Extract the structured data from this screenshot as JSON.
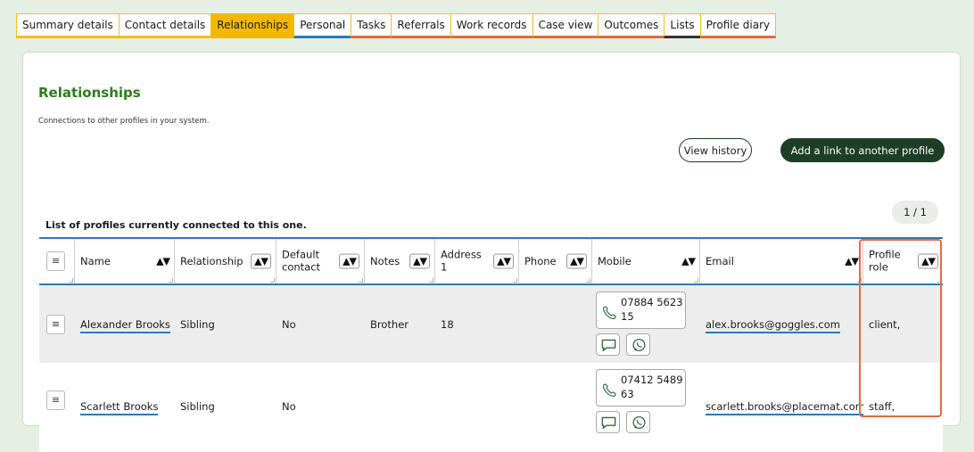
{
  "tabs": [
    {
      "label": "Summary details",
      "active": false
    },
    {
      "label": "Contact details",
      "active": false
    },
    {
      "label": "Relationships",
      "active": true
    },
    {
      "label": "Personal",
      "active": false
    },
    {
      "label": "Tasks",
      "active": false
    },
    {
      "label": "Referrals",
      "active": false
    },
    {
      "label": "Work records",
      "active": false
    },
    {
      "label": "Case view",
      "active": false
    },
    {
      "label": "Outcomes",
      "active": false
    },
    {
      "label": "Lists",
      "active": false
    },
    {
      "label": "Profile diary",
      "active": false
    }
  ],
  "page": {
    "title": "Relationships",
    "description": "Connections to other profiles in your system.",
    "view_history_label": "View history",
    "add_link_label": "Add a link to another profile",
    "pager": "1 / 1",
    "list_caption": "List of profiles currently connected to this one."
  },
  "table": {
    "menu_icon": "≡",
    "sort_icon": "▲▼",
    "headers": {
      "name": "Name",
      "relationship": "Relationship",
      "default_contact": "Default contact",
      "notes": "Notes",
      "address1": "Address 1",
      "phone": "Phone",
      "mobile": "Mobile",
      "email": "Email",
      "profile_role": "Profile role"
    },
    "rows": [
      {
        "name": "Alexander Brooks",
        "relationship": "Sibling",
        "default_contact": "No",
        "notes": "Brother",
        "address1": "18",
        "phone": "",
        "mobile": "07884 562315",
        "email": "alex.brooks@goggles.com",
        "profile_role": "client,"
      },
      {
        "name": "Scarlett Brooks",
        "relationship": "Sibling",
        "default_contact": "No",
        "notes": "",
        "address1": "",
        "phone": "",
        "mobile": "07412 548963",
        "email": "scarlett.brooks@placemat.com",
        "profile_role": "staff,"
      }
    ]
  },
  "colors": {
    "accent_tab": "#f5b800",
    "title_green": "#2e7d1a",
    "button_dark": "#1f3e28",
    "table_rule": "#2a7ab8",
    "highlight": "#e86a45"
  },
  "icons": {
    "phone": "phone-icon",
    "sms": "chat-icon",
    "whatsapp": "whatsapp-icon"
  }
}
